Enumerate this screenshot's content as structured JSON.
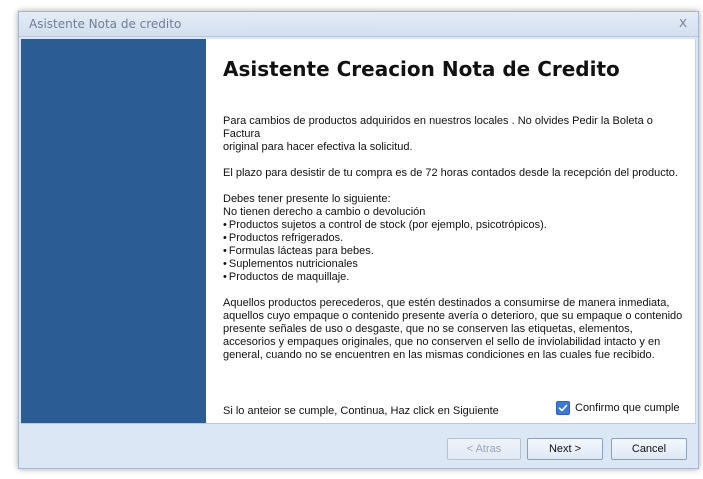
{
  "window": {
    "title": "Asistente Nota de credito",
    "close_glyph": "x"
  },
  "content": {
    "heading": "Asistente Creacion Nota de Credito",
    "paragraph1_lines": [
      "Para cambios de productos adquiridos en nuestros locales . No olvides Pedir la Boleta o Factura",
      "original para hacer efectiva la solicitud."
    ],
    "paragraph2": "El plazo para desistir de tu compra es de 72 horas contados desde la recepción del producto.",
    "list_intro_lines": [
      "Debes tener presente lo siguiente:",
      "No tienen derecho a cambio o devolución"
    ],
    "bullets": [
      "Productos sujetos a control de stock (por ejemplo, psicotrópicos).",
      "Productos refrigerados.",
      "Formulas lácteas para bebes.",
      "Suplementos nutricionales",
      "Productos de maquillaje."
    ],
    "paragraph3_lines": [
      "Aquellos productos perecederos, que estén destinados a consumirse de manera inmediata,",
      "aquellos cuyo empaque o contenido presente avería o deterioro, que su empaque o contenido",
      "presente señales de uso o desgaste, que no se conserven las etiquetas, elementos,",
      "accesorios y empaques originales, que no conserven el sello de inviolabilidad intacto y en",
      "general, cuando no se encuentren en las mismas condiciones en las cuales fue recibido."
    ],
    "footer_note": "Si lo anteior se cumple, Continua, Haz click en Siguiente",
    "confirm_label": "Confirmo que cumple",
    "confirm_checked": true
  },
  "buttons": {
    "back": "< Atras",
    "next": "Next >",
    "cancel": "Cancel"
  },
  "colors": {
    "sidebar": "#2c5c94",
    "checkbox": "#3a7ad6"
  }
}
